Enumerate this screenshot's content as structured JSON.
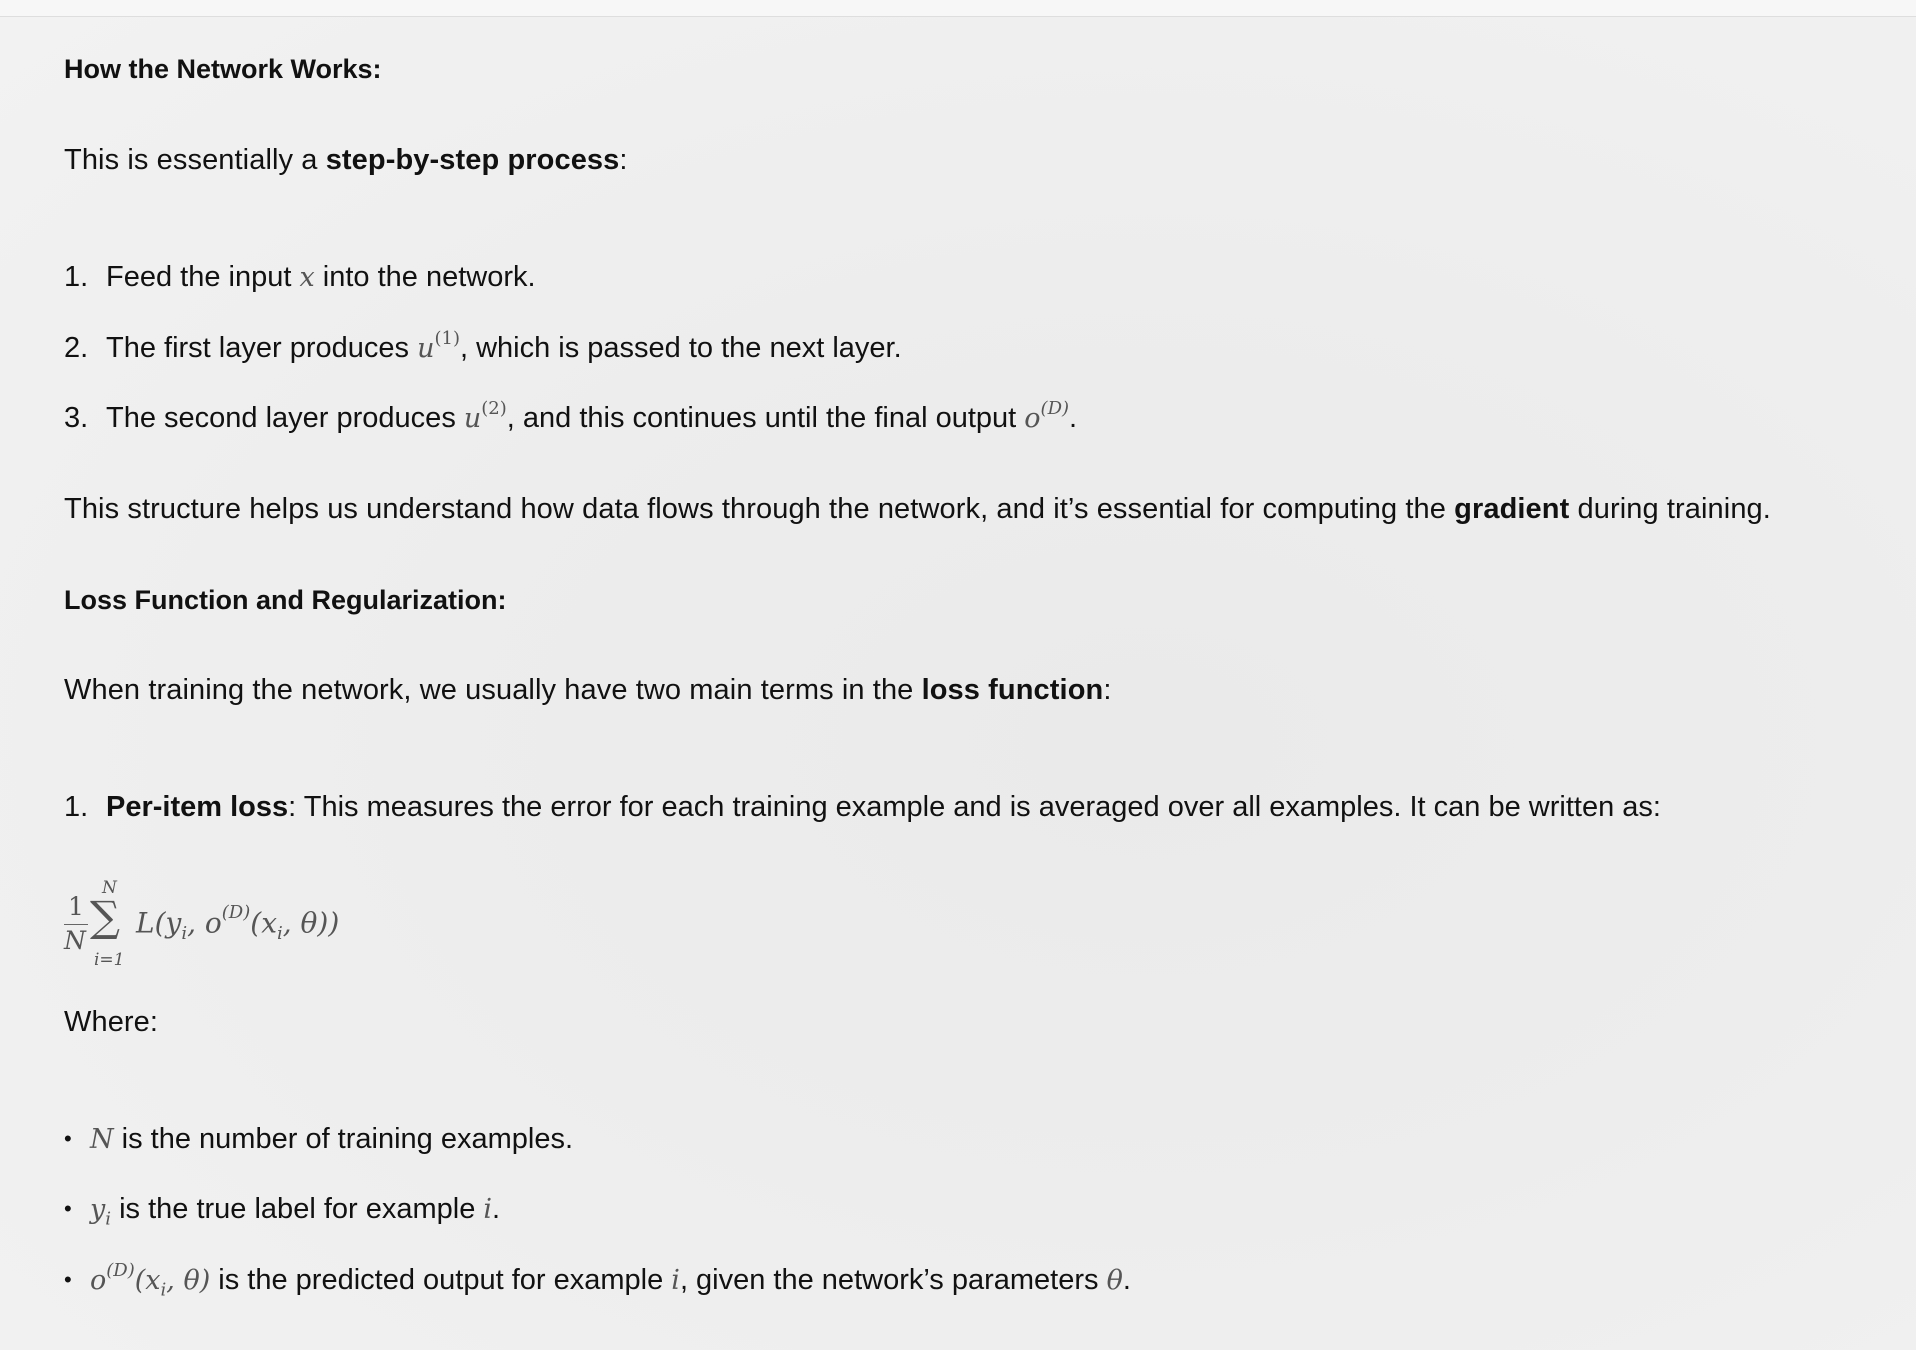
{
  "section1": {
    "heading": "How the Network Works:",
    "intro_prefix": "This is essentially a ",
    "intro_bold": "step-by-step process",
    "intro_suffix": ":",
    "steps": [
      {
        "num": "1.",
        "pre": "Feed the input ",
        "math": "x",
        "post": " into the network."
      },
      {
        "num": "2.",
        "pre": "The first layer produces ",
        "math_base": "u",
        "math_sup": "(1)",
        "post": ", which is passed to the next layer."
      },
      {
        "num": "3.",
        "pre": "The second layer produces ",
        "math_base": "u",
        "math_sup": "(2)",
        "mid": ", and this continues until the final output ",
        "math2_base": "o",
        "math2_sup": "(D)",
        "post": "."
      }
    ],
    "summary_prefix": "This structure helps us understand how data flows through the network, and it’s essential for computing the ",
    "summary_bold": "gradient",
    "summary_suffix": " during training."
  },
  "section2": {
    "heading": "Loss Function and Regularization:",
    "intro_prefix": "When training the network, we usually have two main terms in the ",
    "intro_bold": "loss function",
    "intro_suffix": ":",
    "item1_num": "1.",
    "item1_bold": "Per-item loss",
    "item1_text": ": This measures the error for each training example and is averaged over all examples. It can be written as:",
    "formula": {
      "numerator": "1",
      "denominator": "N",
      "sigma": "∑",
      "upper": "N",
      "lower": "i=1",
      "body_a": "L(y",
      "body_a_sub": "i",
      "body_b": ", o",
      "body_b_sup": "(D)",
      "body_c": "(x",
      "body_c_sub": "i",
      "body_d": ", θ))"
    },
    "where_label": "Where:",
    "bullets": [
      {
        "math": "N",
        "text": " is the number of training examples."
      },
      {
        "math": "y",
        "math_sub": "i",
        "text_a": " is the true label for example ",
        "math2": "i",
        "text_b": "."
      },
      {
        "math": "o",
        "math_sup": "(D)",
        "math_tail": "(x",
        "math_tail_sub": "i",
        "math_tail_end": ", θ)",
        "text_a": " is the predicted output for example ",
        "math2": "i",
        "text_b": ", given the network’s parameters ",
        "math3": "θ",
        "text_c": "."
      }
    ],
    "bullet_glyph": "•"
  }
}
